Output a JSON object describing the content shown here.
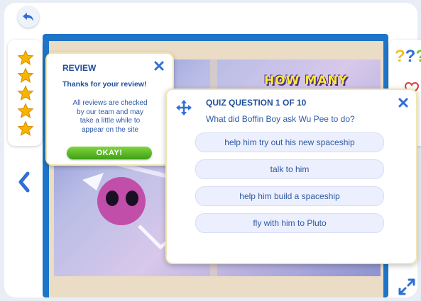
{
  "app": {
    "book_heading": "HOW MANY",
    "review_stars": 5
  },
  "review_popup": {
    "title": "REVIEW",
    "thanks": "Thanks for your review!",
    "message_lines": [
      "All reviews are checked",
      "by our team and may",
      "take a little while to",
      "appear on the site"
    ],
    "ok_label": "OKAY!"
  },
  "quiz_popup": {
    "title": "QUIZ QUESTION 1 OF 10",
    "question": "What did Boffin Boy ask Wu Pee to do?",
    "answers": [
      "help him try out his new spaceship",
      "talk to him",
      "help him build a spaceship",
      "fly with him to Pluto"
    ]
  },
  "icons": {
    "back": "undo-arrow-icon",
    "star": "star-icon",
    "prev": "chevron-left-icon",
    "help": "question-marks-icon",
    "expand": "expand-arrows-icon",
    "move": "move-arrows-icon",
    "close": "close-icon"
  },
  "colors": {
    "accent_blue": "#1f4f9c",
    "book_blue": "#1e74c6",
    "ok_green": "#4fb21f",
    "star_gold": "#f7b500",
    "help_yellow": "#f2c21a"
  }
}
